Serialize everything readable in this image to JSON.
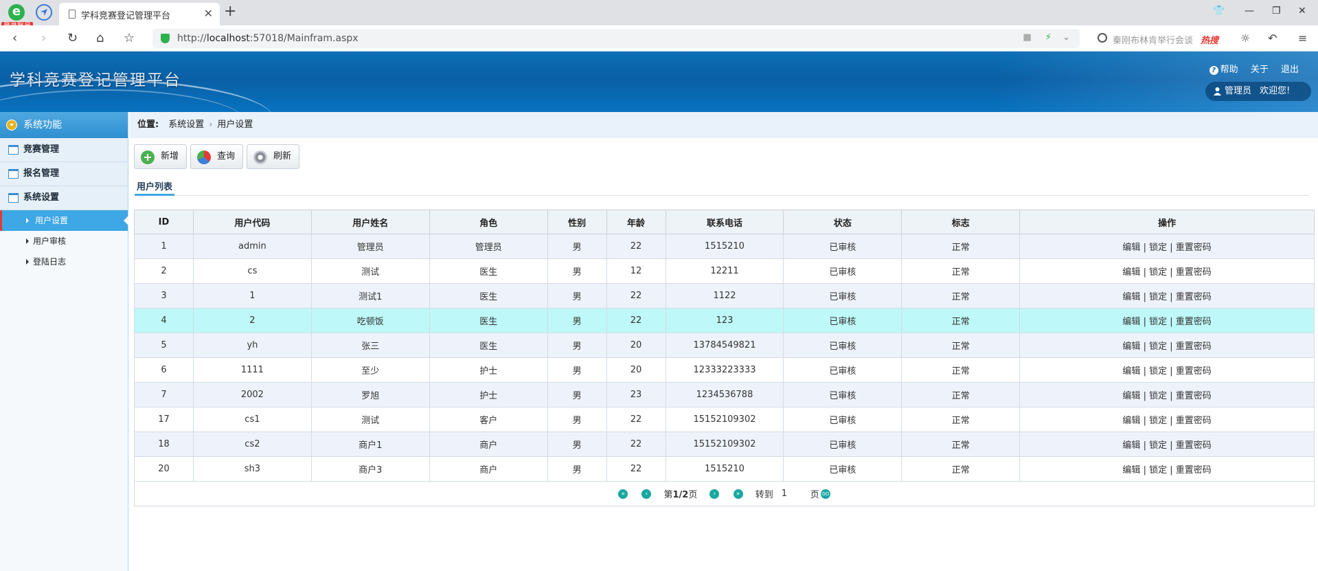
{
  "browser": {
    "badge": "登录账号",
    "tab_title": "学科竞赛登记管理平台",
    "url_prefix": "http://",
    "url_host": "localhost",
    "url_rest": ":57018/Mainfram.aspx",
    "search_placeholder": "秦刚布林肯举行会谈",
    "search_hot": "热搜"
  },
  "app": {
    "title": "学科竞赛登记管理平台",
    "links": {
      "help": "帮助",
      "about": "关于",
      "logout": "退出"
    },
    "user": "管理员",
    "welcome": "欢迎您!"
  },
  "sidebar": {
    "header": "系统功能",
    "groups": [
      {
        "label": "竞赛管理"
      },
      {
        "label": "报名管理"
      },
      {
        "label": "系统设置"
      }
    ],
    "subitems": [
      {
        "label": "用户设置",
        "active": true
      },
      {
        "label": "用户审核",
        "active": false
      },
      {
        "label": "登陆日志",
        "active": false
      }
    ]
  },
  "breadcrumb": {
    "label": "位置:",
    "parent": "系统设置",
    "current": "用户设置"
  },
  "toolbar": {
    "add": "新增",
    "query": "查询",
    "refresh": "刷新"
  },
  "list_title": "用户列表",
  "table": {
    "columns": [
      "ID",
      "用户代码",
      "用户姓名",
      "角色",
      "性别",
      "年龄",
      "联系电话",
      "状态",
      "标志",
      "操作"
    ],
    "rows": [
      [
        "1",
        "admin",
        "管理员",
        "管理员",
        "男",
        "22",
        "1515210",
        "已审核",
        "正常"
      ],
      [
        "2",
        "cs",
        "测试",
        "医生",
        "男",
        "12",
        "12211",
        "已审核",
        "正常"
      ],
      [
        "3",
        "1",
        "测试1",
        "医生",
        "男",
        "22",
        "1122",
        "已审核",
        "正常"
      ],
      [
        "4",
        "2",
        "吃顿饭",
        "医生",
        "男",
        "22",
        "123",
        "已审核",
        "正常"
      ],
      [
        "5",
        "yh",
        "张三",
        "医生",
        "男",
        "20",
        "13784549821",
        "已审核",
        "正常"
      ],
      [
        "6",
        "1111",
        "至少",
        "护士",
        "男",
        "20",
        "12333223333",
        "已审核",
        "正常"
      ],
      [
        "7",
        "2002",
        "罗旭",
        "护士",
        "男",
        "23",
        "1234536788",
        "已审核",
        "正常"
      ],
      [
        "17",
        "cs1",
        "测试",
        "客户",
        "男",
        "22",
        "15152109302",
        "已审核",
        "正常"
      ],
      [
        "18",
        "cs2",
        "商户1",
        "商户",
        "男",
        "22",
        "15152109302",
        "已审核",
        "正常"
      ],
      [
        "20",
        "sh3",
        "商户3",
        "商户",
        "男",
        "22",
        "1515210",
        "已审核",
        "正常"
      ]
    ],
    "actions": {
      "edit": "编辑",
      "lock": "锁定",
      "reset": "重置密码",
      "sep": "|"
    },
    "highlight_row": 3
  },
  "pager": {
    "page_prefix": "第",
    "current": "1",
    "slash": "/",
    "total": "2",
    "page_suffix": "页",
    "goto_label": "转到",
    "goto_value": "1",
    "goto_suffix": "页",
    "first": "«",
    "prev": "‹",
    "next": "›",
    "last": "»",
    "go": "GO"
  },
  "colors": {
    "accent": "#3ea7e5",
    "header_blue": "#0a5fa5",
    "highlight": "#bff8f8",
    "pager": "#18a8a0"
  }
}
